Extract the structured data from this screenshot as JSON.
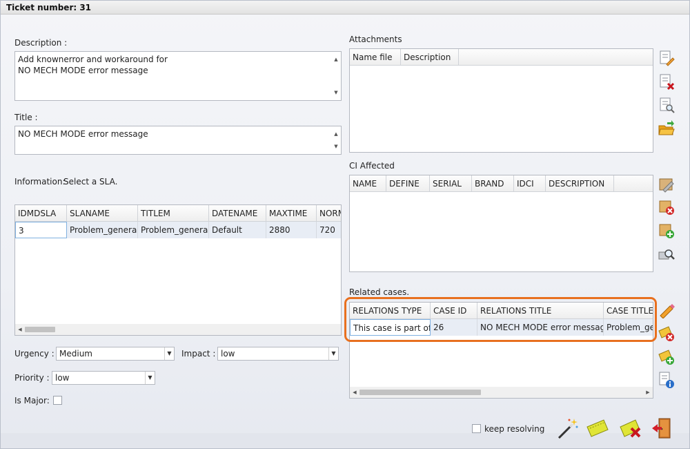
{
  "window": {
    "title": "Ticket number: 31"
  },
  "description": {
    "label": "Description :",
    "value": "Add knownerror and workaround for\nNO MECH MODE error message"
  },
  "title_field": {
    "label": "Title :",
    "value": "NO MECH MODE error message"
  },
  "information": {
    "label": "Information:",
    "hint": "Select a SLA."
  },
  "sla_grid": {
    "columns": [
      "IDMDSLA",
      "SLANAME",
      "TITLEM",
      "DATENAME",
      "MAXTIME",
      "NORM"
    ],
    "rows": [
      [
        "3",
        "Problem_general",
        "Problem_general",
        "Default",
        "2880",
        "720"
      ]
    ]
  },
  "urgency": {
    "label": "Urgency :",
    "value": "Medium"
  },
  "impact": {
    "label": "Impact :",
    "value": "low"
  },
  "priority": {
    "label": "Priority :",
    "value": "low"
  },
  "is_major": {
    "label": "Is Major:"
  },
  "attachments": {
    "label": "Attachments",
    "columns": [
      "Name file",
      "Description"
    ]
  },
  "ci_affected": {
    "label": "CI Affected",
    "columns": [
      "NAME",
      "DEFINE",
      "SERIAL",
      "BRAND",
      "IDCI",
      "DESCRIPTION"
    ]
  },
  "related_cases": {
    "label": "Related cases.",
    "columns": [
      "RELATIONS TYPE",
      "CASE ID",
      "RELATIONS TITLE",
      "CASE TITLE"
    ],
    "rows": [
      [
        "This case is part of",
        "26",
        "NO MECH MODE error message",
        "Problem_general"
      ]
    ]
  },
  "keep_resolving": {
    "label": "keep resolving"
  },
  "colors": {
    "highlight": "#e8701f",
    "selected_row": "#e8edf5"
  }
}
